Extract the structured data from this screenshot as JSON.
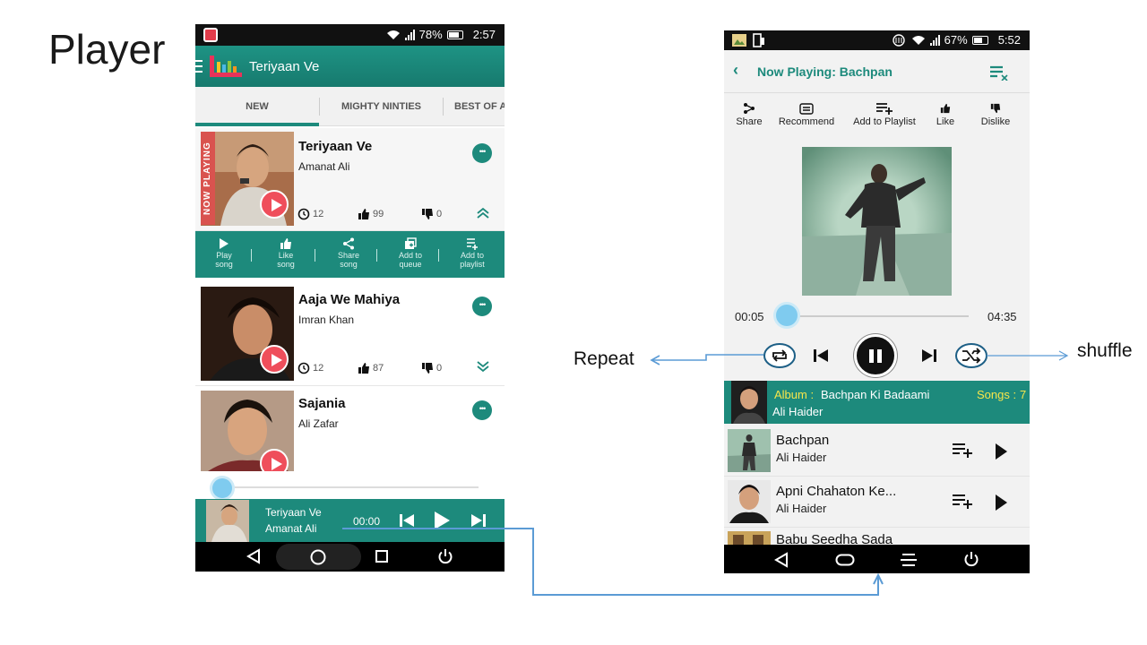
{
  "slide": {
    "title": "Player"
  },
  "left_phone": {
    "status": {
      "battery": "78%",
      "time": "2:57"
    },
    "header": {
      "title": "Teriyaan Ve"
    },
    "tabs": [
      {
        "label": "NEW",
        "active": true
      },
      {
        "label": "MIGHTY NINTIES",
        "active": false
      },
      {
        "label": "BEST OF A",
        "active": false
      }
    ],
    "now_playing_label": "NOW PLAYING",
    "songs": [
      {
        "title": "Teriyaan Ve",
        "artist": "Amanat Ali",
        "plays": "12",
        "likes": "99",
        "dislikes": "0"
      },
      {
        "title": "Aaja We Mahiya",
        "artist": "Imran Khan",
        "plays": "12",
        "likes": "87",
        "dislikes": "0"
      },
      {
        "title": "Sajania",
        "artist": "Ali Zafar"
      }
    ],
    "actions": [
      {
        "line1": "Play",
        "line2": "song"
      },
      {
        "line1": "Like",
        "line2": "song"
      },
      {
        "line1": "Share",
        "line2": "song"
      },
      {
        "line1": "Add to",
        "line2": "queue"
      },
      {
        "line1": "Add to",
        "line2": "playlist"
      }
    ],
    "mini_player": {
      "title": "Teriyaan Ve",
      "artist": "Amanat Ali",
      "time": "00:00"
    }
  },
  "right_phone": {
    "status": {
      "battery": "67%",
      "time": "5:52"
    },
    "header": {
      "title": "Now Playing: Bachpan"
    },
    "actions": [
      {
        "label": "Share"
      },
      {
        "label": "Recommend"
      },
      {
        "label": "Add to Playlist"
      },
      {
        "label": "Like"
      },
      {
        "label": "Dislike"
      }
    ],
    "player": {
      "elapsed": "00:05",
      "duration": "04:35",
      "progress": 0.02
    },
    "album": {
      "label": "Album :",
      "name": "Bachpan Ki Badaami",
      "songs_label": "Songs :",
      "songs_count": "7",
      "artist": "Ali Haider"
    },
    "tracks": [
      {
        "title": "Bachpan",
        "artist": "Ali Haider"
      },
      {
        "title": "Apni Chahaton Ke...",
        "artist": "Ali Haider"
      },
      {
        "title": "Babu Seedha Sada",
        "artist": ""
      }
    ]
  },
  "annotations": {
    "repeat": "Repeat",
    "shuffle": "shuffle"
  },
  "colors": {
    "accent": "#1d8a7c",
    "badge": "#ef4e5b",
    "seek": "#7fcbef",
    "arrow": "#5b9bd5",
    "album_label": "#f7e64a"
  }
}
